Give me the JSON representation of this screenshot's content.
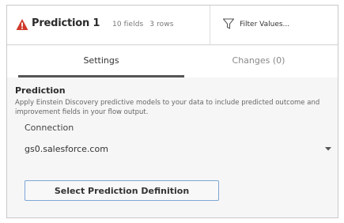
{
  "header": {
    "title": "Prediction 1",
    "fields": "10 fields",
    "rows": "3 rows",
    "filter_label": "Filter Values...",
    "warning_color": "#d03a2b"
  },
  "tabs": [
    {
      "label": "Settings",
      "active": true
    },
    {
      "label": "Changes (0)",
      "active": false
    }
  ],
  "section": {
    "title": "Prediction",
    "description": "Apply Einstein Discovery predictive models to your data to include predicted outcome and improvement fields in your flow output."
  },
  "connection": {
    "label": "Connection",
    "value": "gs0.salesforce.com"
  },
  "button": {
    "label": "Select Prediction Definition"
  },
  "icons": [
    "warning-icon",
    "filter-icon",
    "chevron-down-icon"
  ]
}
